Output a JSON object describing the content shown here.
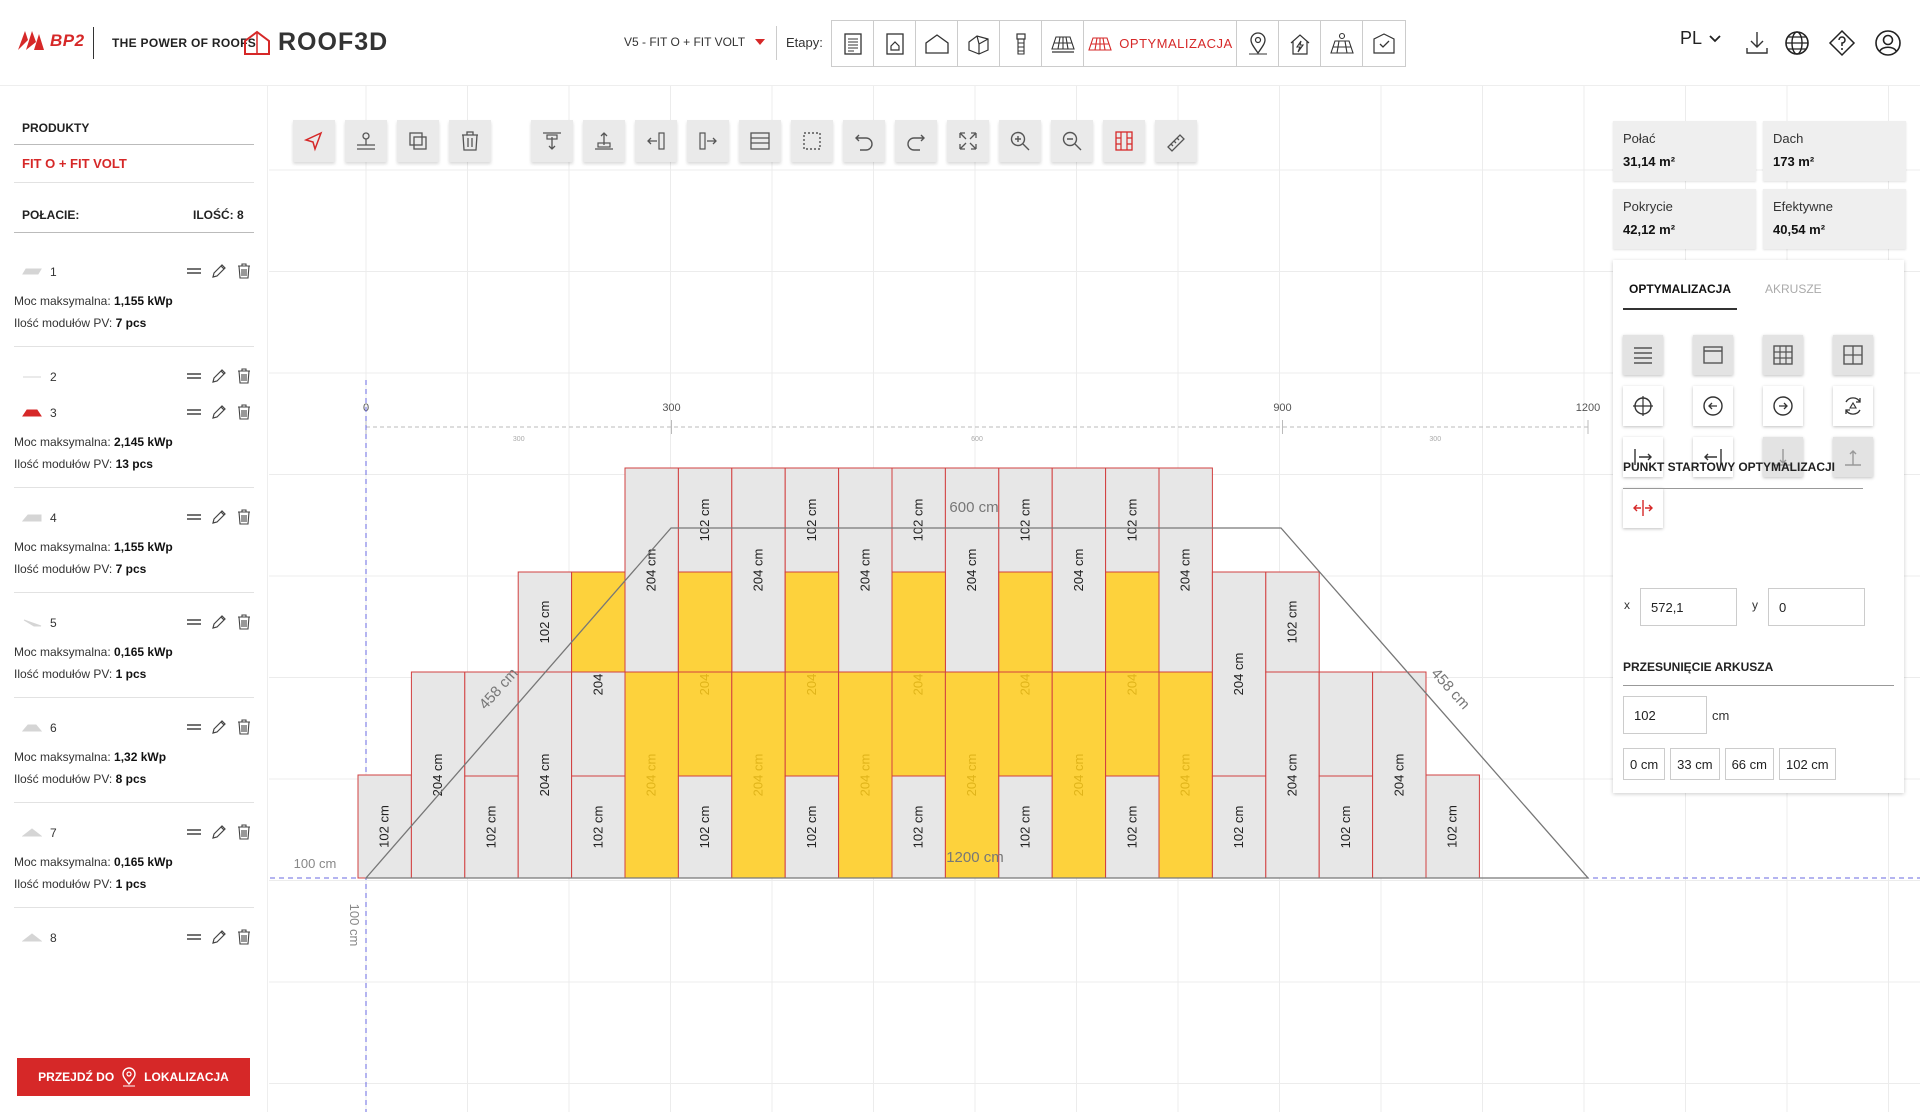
{
  "header": {
    "brand": "BP2",
    "tagline": "THE POWER OF ROOFS",
    "app_name": "ROOF3D",
    "variant": "V5 - FIT O + FIT VOLT",
    "stages_label": "Etapy:",
    "active_stage": "OPTYMALIZACJA",
    "language": "PL",
    "icons": [
      "document-icon",
      "house-doc-icon",
      "roof-outline-icon",
      "house-3d-icon",
      "chimney-icon",
      "solar-roof-icon",
      "optimization-icon",
      "location-pin-icon",
      "lightning-roof-icon",
      "solar-panel-icon",
      "shield-house-icon"
    ]
  },
  "sidebar": {
    "products_title": "PRODUKTY",
    "product_name": "FIT O + FIT VOLT",
    "roofs_title": "POŁACIE:",
    "count_label": "ILOŚĆ: 8",
    "power_label": "Moc maksymalna:",
    "modules_label": "Ilość modułów PV:",
    "roofs": [
      {
        "num": "1",
        "power": "1,155 kWp",
        "modules": "7 pcs",
        "active": false
      },
      {
        "num": "2",
        "power": "",
        "modules": "",
        "active": false
      },
      {
        "num": "3",
        "power": "2,145 kWp",
        "modules": "13 pcs",
        "active": true
      },
      {
        "num": "4",
        "power": "1,155 kWp",
        "modules": "7 pcs",
        "active": false
      },
      {
        "num": "5",
        "power": "0,165 kWp",
        "modules": "1 pcs",
        "active": false
      },
      {
        "num": "6",
        "power": "1,32 kWp",
        "modules": "8 pcs",
        "active": false
      },
      {
        "num": "7",
        "power": "0,165 kWp",
        "modules": "1 pcs",
        "active": false
      },
      {
        "num": "8",
        "power": "",
        "modules": "",
        "active": false
      }
    ],
    "next_button_pre": "PRZEJDŹ DO",
    "next_button_post": "LOKALIZACJA"
  },
  "canvas": {
    "ruler_major": [
      "0",
      "300",
      "900",
      "1200"
    ],
    "ruler_minor": [
      "300",
      "600",
      "300"
    ],
    "offset_label": "100 cm",
    "offset_label_vertical": "100 cm",
    "top_width_label": "600 cm",
    "bottom_width_label": "1200 cm",
    "slope_left_label": "458 cm",
    "slope_right_label": "458 cm",
    "sheet_short": "102 cm",
    "sheet_long": "204 cm",
    "colors": {
      "pv_panel": "#fdd23c",
      "sheet_fill": "#e7e7e7",
      "sheet_stroke": "#d24040",
      "roof_outline": "#777777",
      "guide": "#6a6ae0"
    }
  },
  "toolbar": {
    "tools": [
      "pointer-icon",
      "move-point-icon",
      "copy-icon",
      "trash-icon",
      "align-top-icon",
      "align-bottom-icon",
      "align-left-icon",
      "align-right-icon",
      "sheet-row-icon",
      "select-area-icon",
      "undo-icon",
      "redo-icon",
      "fit-view-icon",
      "zoom-in-icon",
      "zoom-out-icon",
      "sheet-layout-icon",
      "ruler-icon"
    ]
  },
  "stats": [
    {
      "label": "Połać",
      "value": "31,14 m²"
    },
    {
      "label": "Dach",
      "value": "173 m²"
    },
    {
      "label": "Pokrycie",
      "value": "42,12 m²"
    },
    {
      "label": "Efektywne",
      "value": "40,54 m²"
    }
  ],
  "optimization_panel": {
    "tab_active": "OPTYMALIZACJA",
    "tab_inactive": "AKRUSZE",
    "start_point_title": "PUNKT STARTOWY OPTYMALIZACJI",
    "x_label": "x",
    "x_value": "572,1",
    "y_label": "y",
    "y_value": "0",
    "shift_title": "PRZESUNIĘCIE ARKUSZA",
    "shift_value": "102",
    "shift_unit": "cm",
    "chips": [
      "0 cm",
      "33 cm",
      "66 cm",
      "102 cm"
    ]
  }
}
